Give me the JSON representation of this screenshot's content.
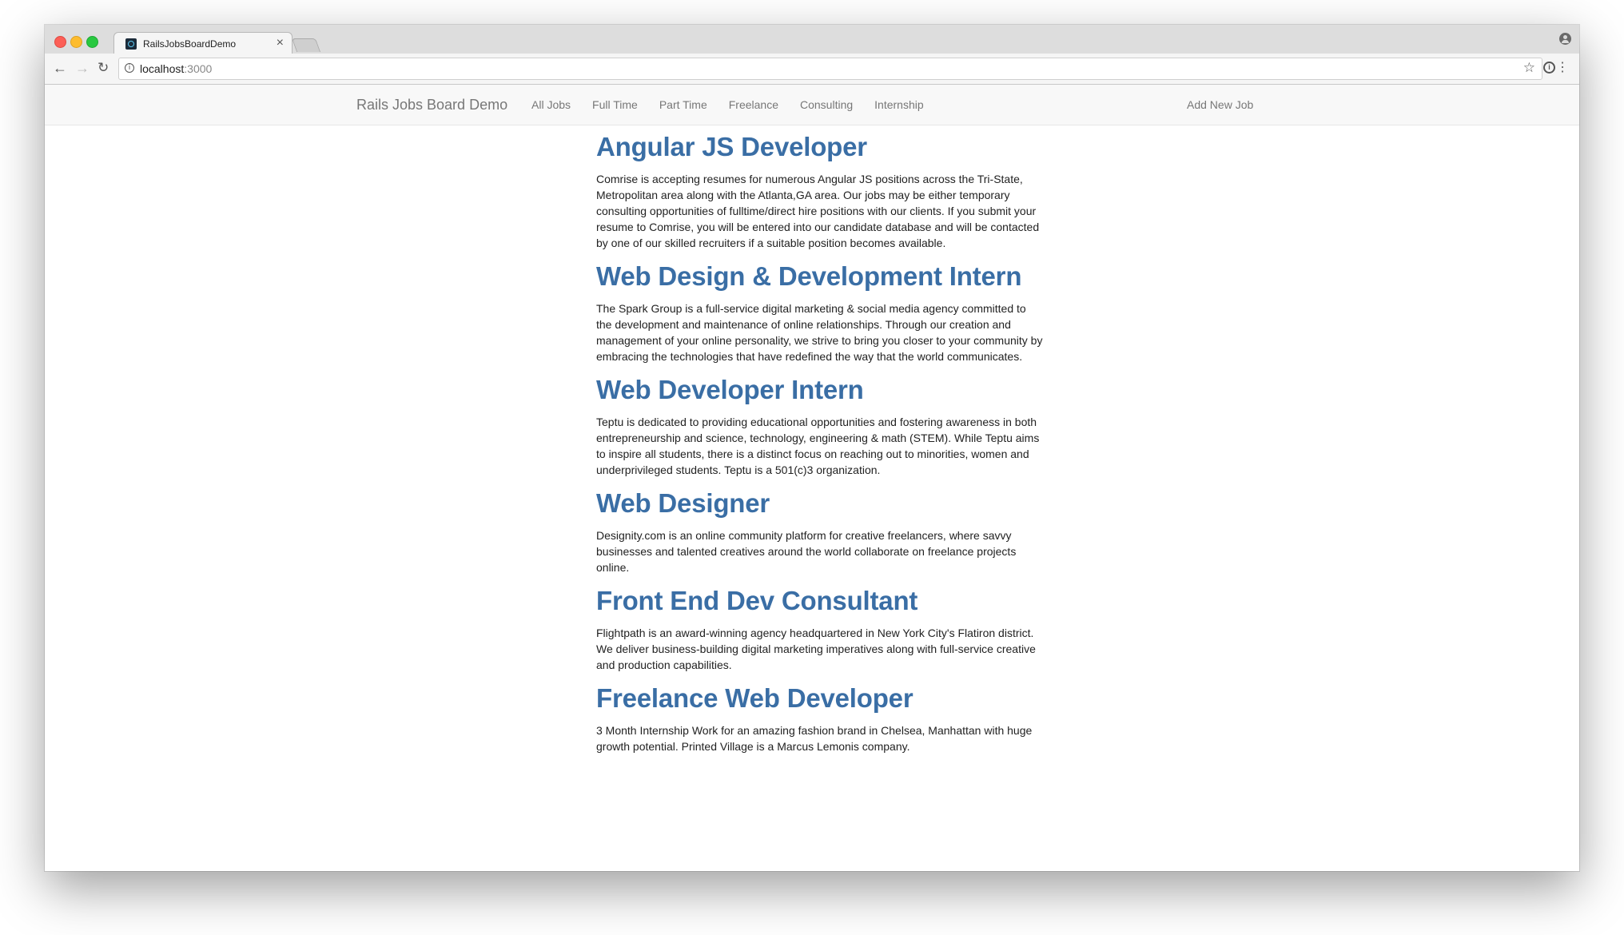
{
  "browser": {
    "tab_title": "RailsJobsBoardDemo",
    "tab_close": "×",
    "url_host": "localhost",
    "url_port": ":3000"
  },
  "navbar": {
    "brand": "Rails Jobs Board Demo",
    "links": [
      "All Jobs",
      "Full Time",
      "Part Time",
      "Freelance",
      "Consulting",
      "Internship"
    ],
    "add_new_job": "Add New Job"
  },
  "jobs": [
    {
      "title": "Angular JS Developer",
      "description": "Comrise is accepting resumes for numerous Angular JS positions across the Tri-State, Metropolitan area along with the Atlanta,GA area. Our jobs may be either temporary consulting opportunities of fulltime/direct hire positions with our clients. If you submit your resume to Comrise, you will be entered into our candidate database and will be contacted by one of our skilled recruiters if a suitable position becomes available."
    },
    {
      "title": "Web Design & Development Intern",
      "description": "The Spark Group is a full-service digital marketing & social media agency committed to the development and maintenance of online relationships. Through our creation and management of your online personality, we strive to bring you closer to your community by embracing the technologies that have redefined the way that the world communicates."
    },
    {
      "title": "Web Developer Intern",
      "description": "Teptu is dedicated to providing educational opportunities and fostering awareness in both entrepreneurship and science, technology, engineering & math (STEM). While Teptu aims to inspire all students, there is a distinct focus on reaching out to minorities, women and underprivileged students. Teptu is a 501(c)3 organization."
    },
    {
      "title": "Web Designer",
      "description": "Designity.com is an online community platform for creative freelancers, where savvy businesses and talented creatives around the world collaborate on freelance projects online."
    },
    {
      "title": "Front End Dev Consultant",
      "description": "Flightpath is an award-winning agency headquartered in New York City's Flatiron district. We deliver business-building digital marketing imperatives along with full-service creative and production capabilities."
    },
    {
      "title": "Freelance Web Developer",
      "description": "3 Month Internship Work for an amazing fashion brand in Chelsea, Manhattan with huge growth potential. Printed Village is a Marcus Lemonis company."
    }
  ],
  "icons": {
    "back": "arrow-left-icon",
    "forward": "arrow-right-icon",
    "reload": "reload-icon",
    "info": "info-icon",
    "bookmark": "star-icon",
    "extension": "extension-icon",
    "menu": "kebab-menu-icon",
    "profile": "profile-icon"
  },
  "colors": {
    "job_title": "#3a6ea5",
    "nav_text": "#777777",
    "navbar_bg": "#f8f8f8"
  }
}
